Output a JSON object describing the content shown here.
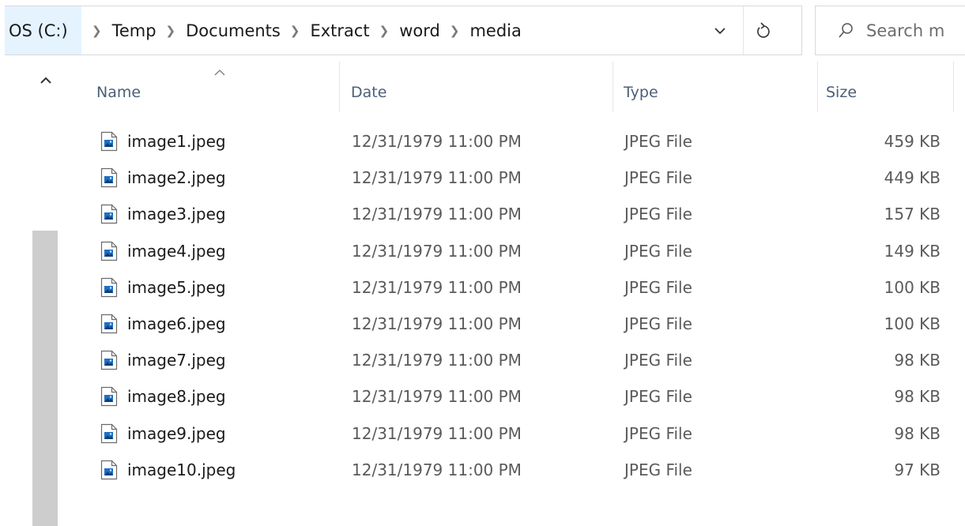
{
  "address_bar": {
    "root": "OS (C:)",
    "breadcrumbs": [
      "Temp",
      "Documents",
      "Extract",
      "word",
      "media"
    ]
  },
  "search": {
    "placeholder": "Search m"
  },
  "columns": {
    "name": "Name",
    "date": "Date",
    "type": "Type",
    "size": "Size"
  },
  "files": [
    {
      "name": "image1.jpeg",
      "date": "12/31/1979 11:00 PM",
      "type": "JPEG File",
      "size": "459 KB"
    },
    {
      "name": "image2.jpeg",
      "date": "12/31/1979 11:00 PM",
      "type": "JPEG File",
      "size": "449 KB"
    },
    {
      "name": "image3.jpeg",
      "date": "12/31/1979 11:00 PM",
      "type": "JPEG File",
      "size": "157 KB"
    },
    {
      "name": "image4.jpeg",
      "date": "12/31/1979 11:00 PM",
      "type": "JPEG File",
      "size": "149 KB"
    },
    {
      "name": "image5.jpeg",
      "date": "12/31/1979 11:00 PM",
      "type": "JPEG File",
      "size": "100 KB"
    },
    {
      "name": "image6.jpeg",
      "date": "12/31/1979 11:00 PM",
      "type": "JPEG File",
      "size": "100 KB"
    },
    {
      "name": "image7.jpeg",
      "date": "12/31/1979 11:00 PM",
      "type": "JPEG File",
      "size": "98 KB"
    },
    {
      "name": "image8.jpeg",
      "date": "12/31/1979 11:00 PM",
      "type": "JPEG File",
      "size": "98 KB"
    },
    {
      "name": "image9.jpeg",
      "date": "12/31/1979 11:00 PM",
      "type": "JPEG File",
      "size": "98 KB"
    },
    {
      "name": "image10.jpeg",
      "date": "12/31/1979 11:00 PM",
      "type": "JPEG File",
      "size": "97 KB"
    }
  ],
  "icons": {
    "dropdown": "chevron-down-icon",
    "refresh": "refresh-icon",
    "search": "search-icon",
    "scroll_up": "scroll-up-icon",
    "sort": "sort-ascending-icon",
    "file": "jpeg-file-icon"
  },
  "colors": {
    "root_crumb_bg": "#e5f3ff",
    "header_text": "#4c607a",
    "icon_blue": "#1e6fc4"
  }
}
